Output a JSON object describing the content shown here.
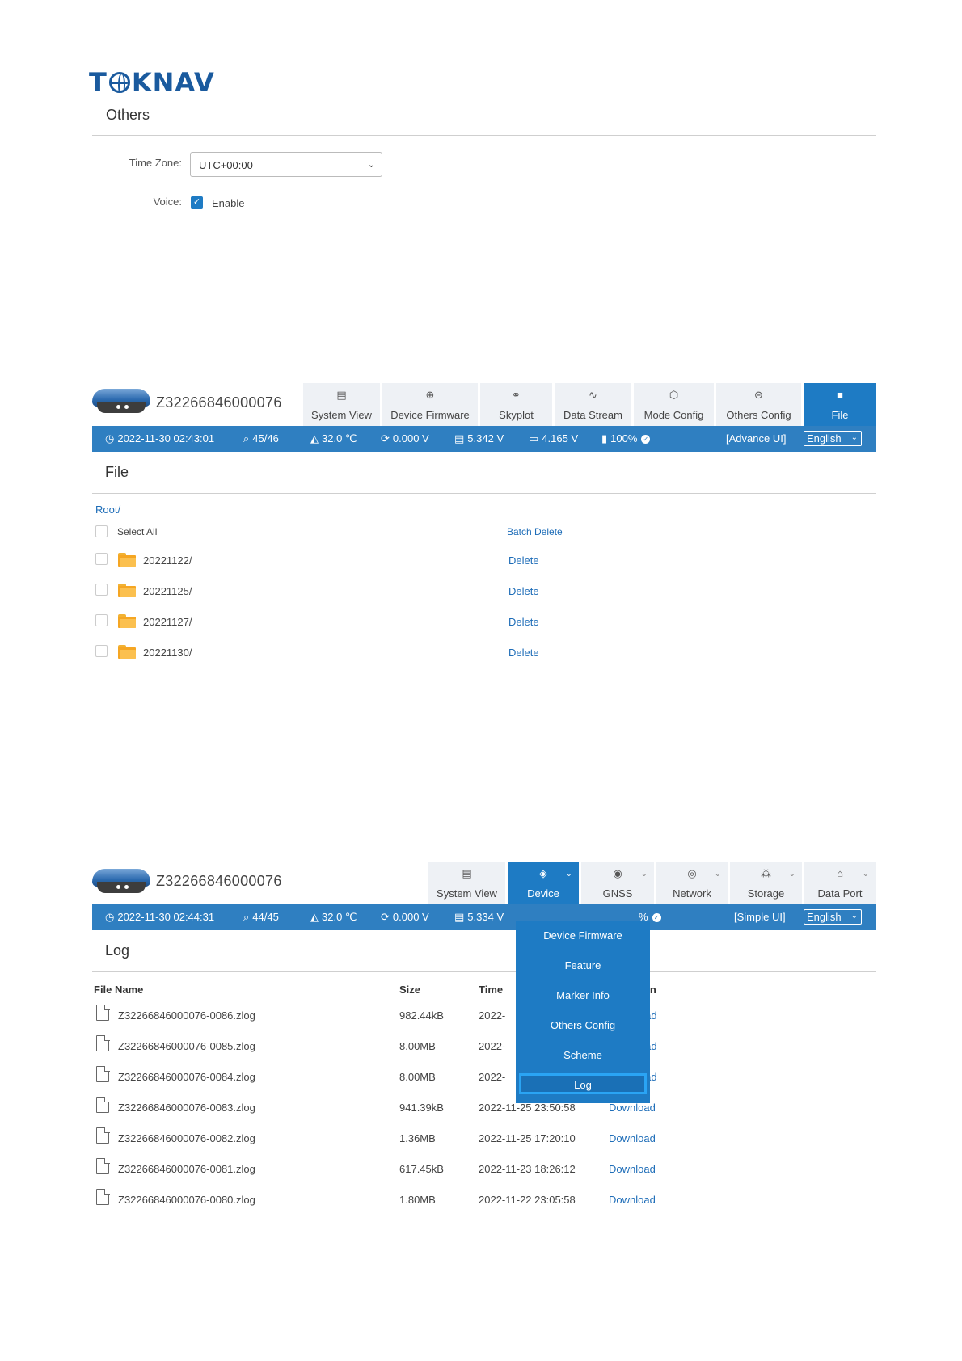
{
  "logo": {
    "t": "T",
    "rest": "KNAV"
  },
  "others": {
    "title": "Others",
    "timezone_label": "Time Zone:",
    "timezone_value": "UTC+00:00",
    "voice_label": "Voice:",
    "voice_enable": "Enable"
  },
  "file_page": {
    "serial": "Z32266846000076",
    "nav": [
      "System View",
      "Device Firmware",
      "Skyplot",
      "Data Stream",
      "Mode Config",
      "Others Config",
      "File"
    ],
    "status": {
      "datetime": "2022-11-30 02:43:01",
      "sats": "45/46",
      "temp": "32.0 ℃",
      "v1": "0.000 V",
      "v2": "5.342 V",
      "v3": "4.165 V",
      "battery": "100%",
      "ui_mode": "[Advance UI]",
      "language": "English"
    },
    "title": "File",
    "path": "Root/",
    "select_all": "Select All",
    "batch_delete": "Batch Delete",
    "folders": [
      {
        "name": "20221122/",
        "action": "Delete"
      },
      {
        "name": "20221125/",
        "action": "Delete"
      },
      {
        "name": "20221127/",
        "action": "Delete"
      },
      {
        "name": "20221130/",
        "action": "Delete"
      }
    ]
  },
  "log_page": {
    "serial": "Z32266846000076",
    "nav": [
      "System View",
      "Device",
      "GNSS",
      "Network",
      "Storage",
      "Data Port"
    ],
    "status": {
      "datetime": "2022-11-30 02:44:31",
      "sats": "44/45",
      "temp": "32.0 ℃",
      "v1": "0.000 V",
      "v2": "5.334 V",
      "battery_tail": "%",
      "ui_mode": "[Simple UI]",
      "language": "English"
    },
    "title": "Log",
    "headers": {
      "name": "File Name",
      "size": "Size",
      "time": "Time",
      "action_tail": "tion"
    },
    "rows": [
      {
        "name": "Z32266846000076-0086.zlog",
        "size": "982.44kB",
        "time": "2022-",
        "action": "load"
      },
      {
        "name": "Z32266846000076-0085.zlog",
        "size": "8.00MB",
        "time": "2022-",
        "action": "load"
      },
      {
        "name": "Z32266846000076-0084.zlog",
        "size": "8.00MB",
        "time": "2022-",
        "action": "load"
      },
      {
        "name": "Z32266846000076-0083.zlog",
        "size": "941.39kB",
        "time": "2022-11-25 23:50:58",
        "action": "Download"
      },
      {
        "name": "Z32266846000076-0082.zlog",
        "size": "1.36MB",
        "time": "2022-11-25 17:20:10",
        "action": "Download"
      },
      {
        "name": "Z32266846000076-0081.zlog",
        "size": "617.45kB",
        "time": "2022-11-23 18:26:12",
        "action": "Download"
      },
      {
        "name": "Z32266846000076-0080.zlog",
        "size": "1.80MB",
        "time": "2022-11-22 23:05:58",
        "action": "Download"
      }
    ],
    "device_menu": [
      "Device Firmware",
      "Feature",
      "Marker Info",
      "Others Config",
      "Scheme",
      "Log"
    ]
  },
  "colors": {
    "brand": "#1a5a9e",
    "accent": "#1e7bc4",
    "status_bar": "#2f7fc1",
    "link": "#1e6db8",
    "folder": "#f5a623"
  }
}
